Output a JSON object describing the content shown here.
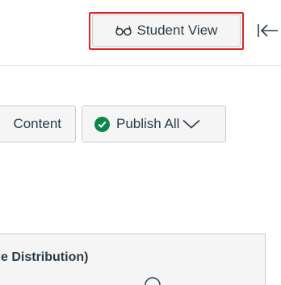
{
  "header": {
    "student_view_label": "Student View"
  },
  "actions": {
    "content_label": "Content",
    "publish_all_label": "Publish All"
  },
  "module": {
    "title": "e Distribution)"
  }
}
